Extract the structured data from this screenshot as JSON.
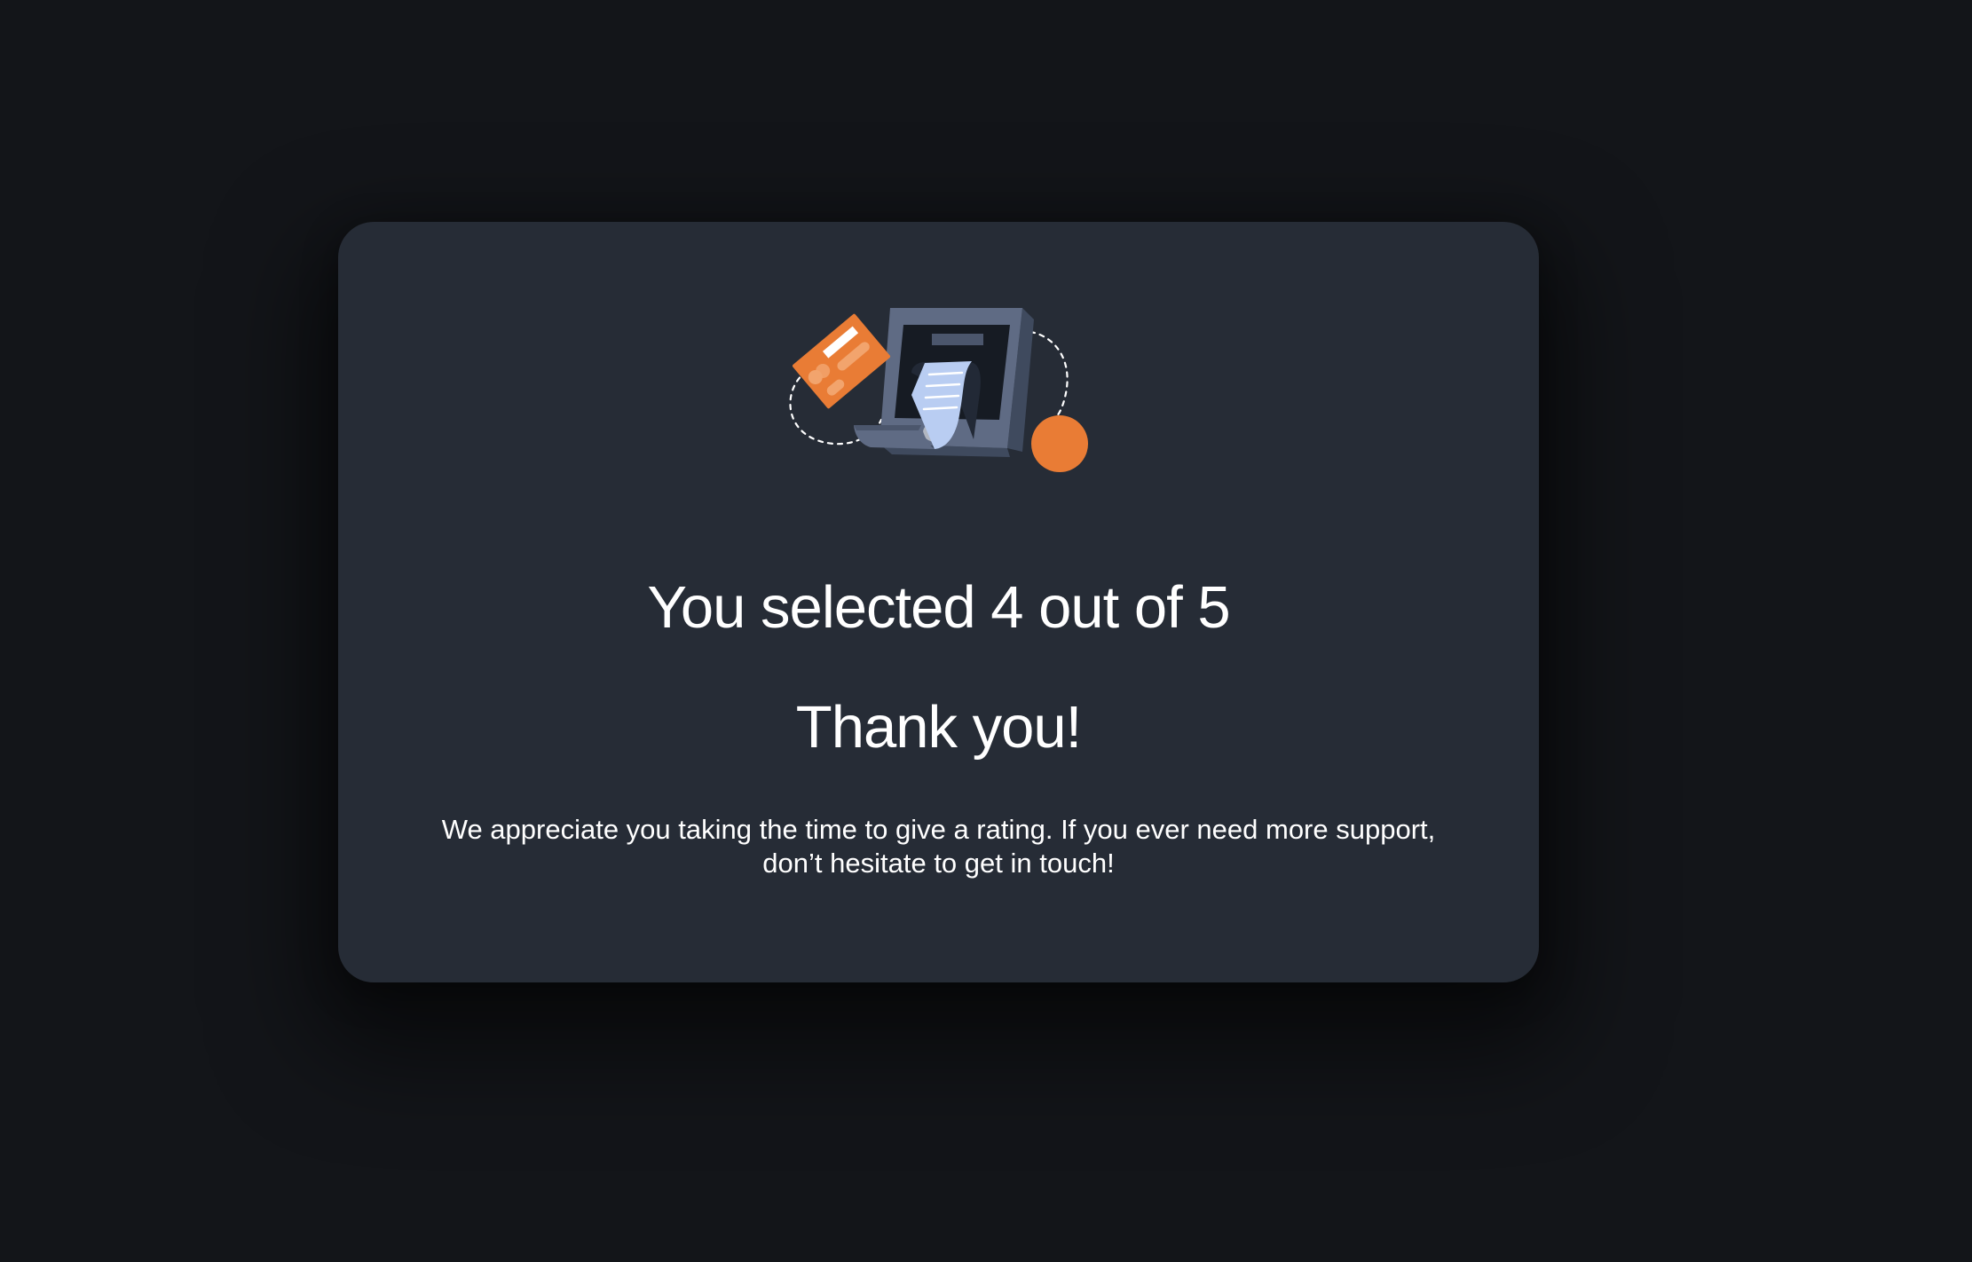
{
  "dialog": {
    "rating_text": "You selected 4 out of 5",
    "heading": "Thank you!",
    "message": "We appreciate you taking the time to give a rating. If you ever need more support, don’t hesitate to get in touch!",
    "illustration_icon": "phone-payment-receipt-icon"
  },
  "colors": {
    "page_background": "#131519",
    "card_background": "#262c36",
    "accent_orange": "#e97c35",
    "phone_body": "#5f6b84",
    "receipt": "#b9cdf2",
    "text": "#ffffff"
  }
}
